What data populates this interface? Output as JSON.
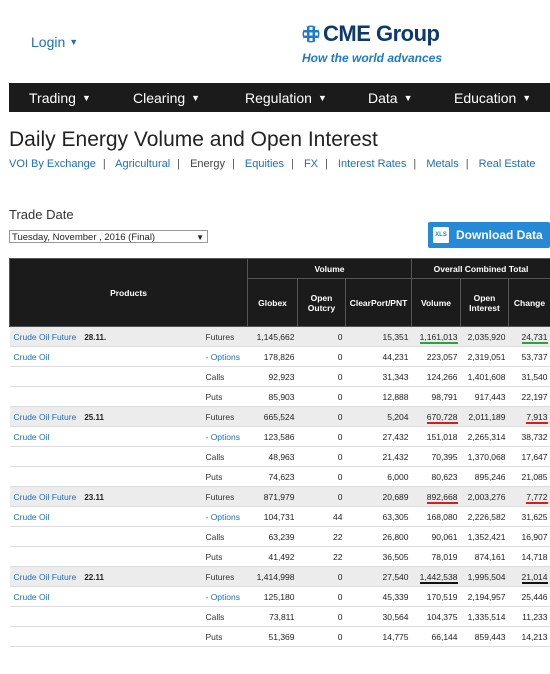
{
  "header": {
    "login_label": "Login",
    "brand_name": "CME Group",
    "brand_tagline": "How the world advances"
  },
  "nav": [
    {
      "label": "Trading"
    },
    {
      "label": "Clearing"
    },
    {
      "label": "Regulation"
    },
    {
      "label": "Data"
    },
    {
      "label": "Education"
    }
  ],
  "page_title": "Daily Energy Volume and Open Interest",
  "breadcrumbs": [
    "VOI By Exchange",
    "Agricultural",
    "Energy",
    "Equities",
    "FX",
    "Interest Rates",
    "Metals",
    "Real Estate"
  ],
  "breadcrumb_current": "Energy",
  "trade_date": {
    "label": "Trade Date",
    "selected": "Tuesday, November     , 2016 (Final)"
  },
  "download_button": {
    "label": "Download Data",
    "icon_text": "XLS"
  },
  "table": {
    "headers": {
      "products": "Products",
      "volume_group": "Volume",
      "overall_group": "Overall Combined Total",
      "globex": "Globex",
      "open_outcry": "Open Outcry",
      "clearport": "ClearPort/PNT",
      "volume": "Volume",
      "open_interest": "Open Interest",
      "change": "Change"
    },
    "groups": [
      {
        "note": "28.11.",
        "highlight": "green",
        "rows": [
          {
            "product": "Crude Oil Future",
            "type": "Futures",
            "globex": "1,145,662",
            "outcry": "0",
            "clearport": "15,351",
            "volume": "1,161,013",
            "oi": "2,035,920",
            "change": "24,731"
          },
          {
            "product": "Crude Oil",
            "type": "- Options",
            "globex": "178,826",
            "outcry": "0",
            "clearport": "44,231",
            "volume": "223,057",
            "oi": "2,319,051",
            "change": "53,737"
          },
          {
            "product": "",
            "type": "Calls",
            "globex": "92,923",
            "outcry": "0",
            "clearport": "31,343",
            "volume": "124,266",
            "oi": "1,401,608",
            "change": "31,540"
          },
          {
            "product": "",
            "type": "Puts",
            "globex": "85,903",
            "outcry": "0",
            "clearport": "12,888",
            "volume": "98,791",
            "oi": "917,443",
            "change": "22,197"
          }
        ]
      },
      {
        "note": "25.11",
        "highlight": "red",
        "rows": [
          {
            "product": "Crude Oil Future",
            "type": "Futures",
            "globex": "665,524",
            "outcry": "0",
            "clearport": "5,204",
            "volume": "670,728",
            "oi": "2,011,189",
            "change": "7,913"
          },
          {
            "product": "Crude Oil",
            "type": "- Options",
            "globex": "123,586",
            "outcry": "0",
            "clearport": "27,432",
            "volume": "151,018",
            "oi": "2,265,314",
            "change": "38,732"
          },
          {
            "product": "",
            "type": "Calls",
            "globex": "48,963",
            "outcry": "0",
            "clearport": "21,432",
            "volume": "70,395",
            "oi": "1,370,068",
            "change": "17,647"
          },
          {
            "product": "",
            "type": "Puts",
            "globex": "74,623",
            "outcry": "0",
            "clearport": "6,000",
            "volume": "80,623",
            "oi": "895,246",
            "change": "21,085"
          }
        ]
      },
      {
        "note": "23.11",
        "highlight": "red",
        "rows": [
          {
            "product": "Crude Oil Future",
            "type": "Futures",
            "globex": "871,979",
            "outcry": "0",
            "clearport": "20,689",
            "volume": "892,668",
            "oi": "2,003,276",
            "change": "7,772"
          },
          {
            "product": "Crude Oil",
            "type": "- Options",
            "globex": "104,731",
            "outcry": "44",
            "clearport": "63,305",
            "volume": "168,080",
            "oi": "2,226,582",
            "change": "31,625"
          },
          {
            "product": "",
            "type": "Calls",
            "globex": "63,239",
            "outcry": "22",
            "clearport": "26,800",
            "volume": "90,061",
            "oi": "1,352,421",
            "change": "16,907"
          },
          {
            "product": "",
            "type": "Puts",
            "globex": "41,492",
            "outcry": "22",
            "clearport": "36,505",
            "volume": "78,019",
            "oi": "874,161",
            "change": "14,718"
          }
        ]
      },
      {
        "note": "22.11",
        "highlight": "black",
        "rows": [
          {
            "product": "Crude Oil Future",
            "type": "Futures",
            "globex": "1,414,998",
            "outcry": "0",
            "clearport": "27,540",
            "volume": "1,442,538",
            "oi": "1,995,504",
            "change": "21,014"
          },
          {
            "product": "Crude Oil",
            "type": "- Options",
            "globex": "125,180",
            "outcry": "0",
            "clearport": "45,339",
            "volume": "170,519",
            "oi": "2,194,957",
            "change": "25,446"
          },
          {
            "product": "",
            "type": "Calls",
            "globex": "73,811",
            "outcry": "0",
            "clearport": "30,564",
            "volume": "104,375",
            "oi": "1,335,514",
            "change": "11,233"
          },
          {
            "product": "",
            "type": "Puts",
            "globex": "51,369",
            "outcry": "0",
            "clearport": "14,775",
            "volume": "66,144",
            "oi": "859,443",
            "change": "14,213"
          }
        ]
      }
    ]
  },
  "colors": {
    "nav_bg": "#1b1b1b",
    "link": "#1f6fb5",
    "button": "#2589d6",
    "highlight_green": "#2aa33a",
    "highlight_red": "#d21e1e",
    "highlight_black": "#111111"
  }
}
